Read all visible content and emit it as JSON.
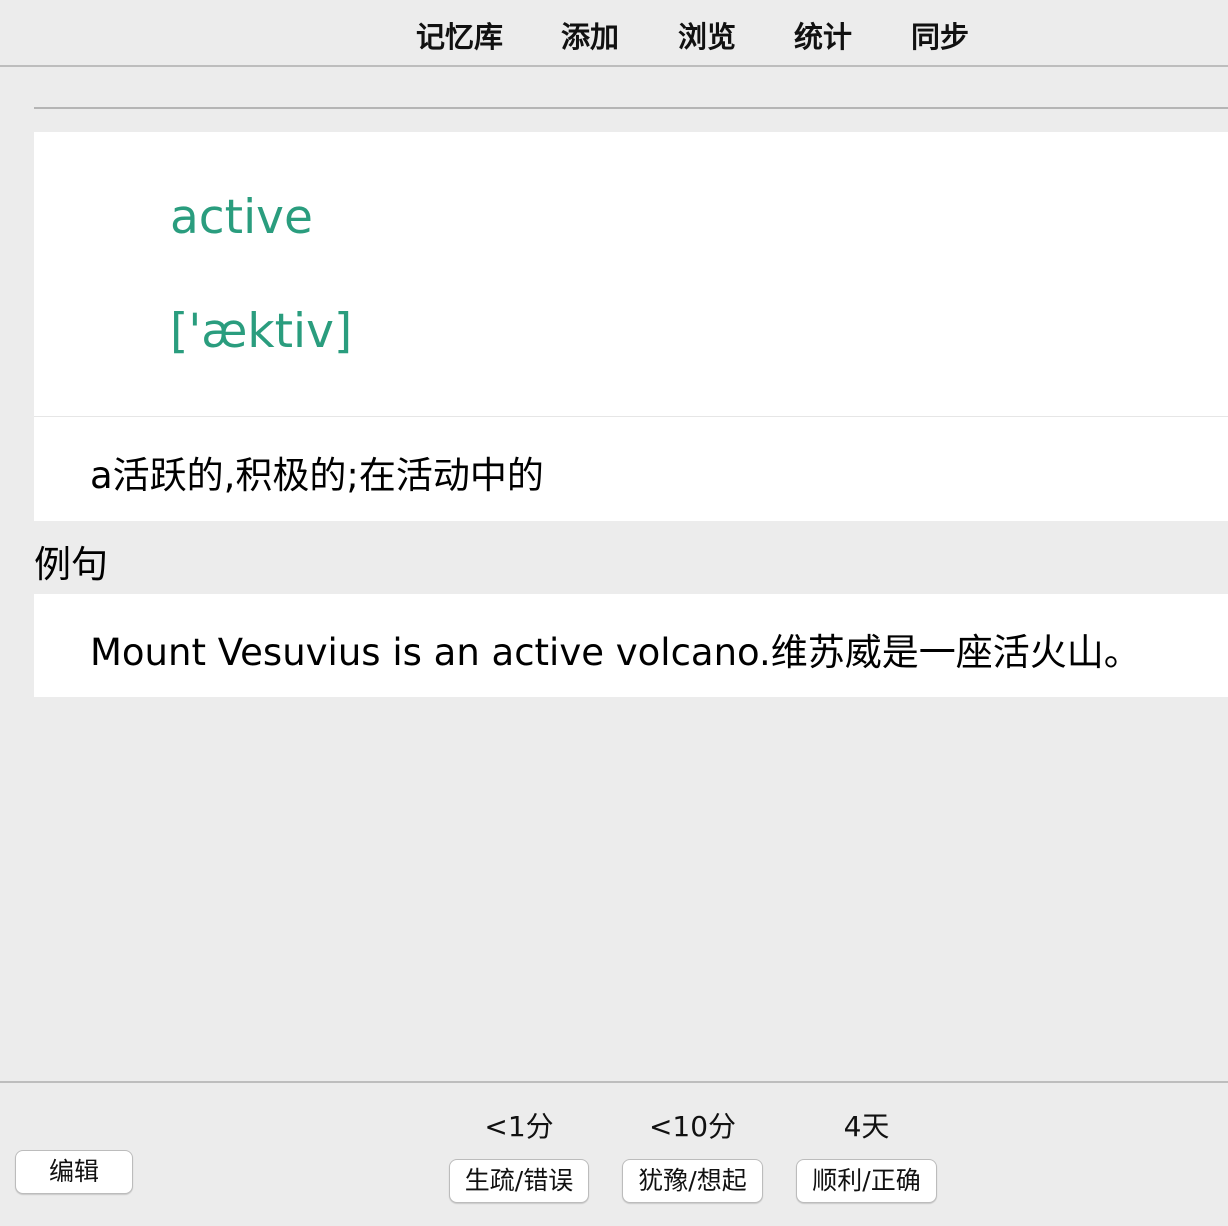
{
  "nav": {
    "items": [
      {
        "label": "记忆库"
      },
      {
        "label": "添加"
      },
      {
        "label": "浏览"
      },
      {
        "label": "统计"
      },
      {
        "label": "同步"
      }
    ]
  },
  "card": {
    "word": "active",
    "phonetic": "['æktiv]",
    "definition": "a活跃的,积极的;在活动中的",
    "example_label": "例句",
    "example": "Mount Vesuvius is an active volcano.维苏威是一座活火山。",
    "accent_color": "#2a9d7e"
  },
  "bottom": {
    "edit_label": "编辑",
    "answers": [
      {
        "interval": "<1分",
        "label": "生疏/错误"
      },
      {
        "interval": "<10分",
        "label": "犹豫/想起"
      },
      {
        "interval": "4天",
        "label": "顺利/正确"
      }
    ]
  }
}
